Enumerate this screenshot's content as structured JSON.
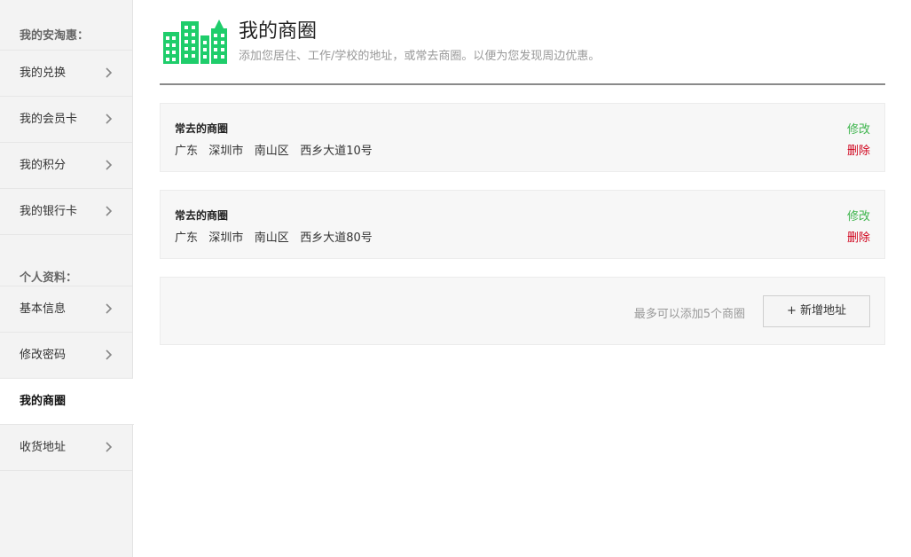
{
  "sidebar": {
    "section1": "我的安淘惠：",
    "items1": [
      {
        "label": "我的兑换"
      },
      {
        "label": "我的会员卡"
      },
      {
        "label": "我的积分"
      },
      {
        "label": "我的银行卡"
      }
    ],
    "section2": "个人资料：",
    "items2": [
      {
        "label": "基本信息"
      },
      {
        "label": "修改密码"
      },
      {
        "label": "我的商圈",
        "active": true
      },
      {
        "label": "收货地址"
      }
    ]
  },
  "header": {
    "title": "我的商圈",
    "subtitle": "添加您居住、工作/学校的地址，或常去商圈。以便为您发现周边优惠。",
    "logo_icon": "city-buildings-icon",
    "accent_color": "#1fcd6b"
  },
  "areas": [
    {
      "title": "常去的商圈",
      "address": "广东   深圳市   南山区   西乡大道10号",
      "edit": "修改",
      "delete": "删除"
    },
    {
      "title": "常去的商圈",
      "address": "广东   深圳市   南山区   西乡大道80号",
      "edit": "修改",
      "delete": "删除"
    }
  ],
  "add": {
    "hint": "最多可以添加5个商圈",
    "button": "+ 新增地址"
  },
  "colors": {
    "edit": "#3cb44b",
    "delete": "#d0021b"
  }
}
